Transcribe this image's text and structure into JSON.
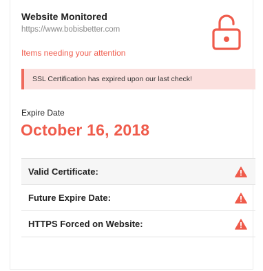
{
  "site": {
    "title": "Website Monitored",
    "url": "https://www.bobisbetter.com",
    "status_icon": "unlocked-padlock-icon"
  },
  "attention": {
    "heading": "Items needing your attention",
    "alert_message": "SSL Certification has expired upon our last check!"
  },
  "expiry": {
    "label": "Expire Date",
    "date": "October 16, 2018"
  },
  "checks": [
    {
      "label": "Valid Certificate:",
      "status": "warning",
      "icon": "warning-triangle-icon"
    },
    {
      "label": "Future Expire Date:",
      "status": "warning",
      "icon": "warning-triangle-icon"
    },
    {
      "label": "HTTPS Forced on Website:",
      "status": "warning",
      "icon": "warning-triangle-icon"
    }
  ],
  "colors": {
    "accent": "#ef5b4b",
    "alert_background": "#fbe0de",
    "alert_border": "#ef6b5d"
  }
}
